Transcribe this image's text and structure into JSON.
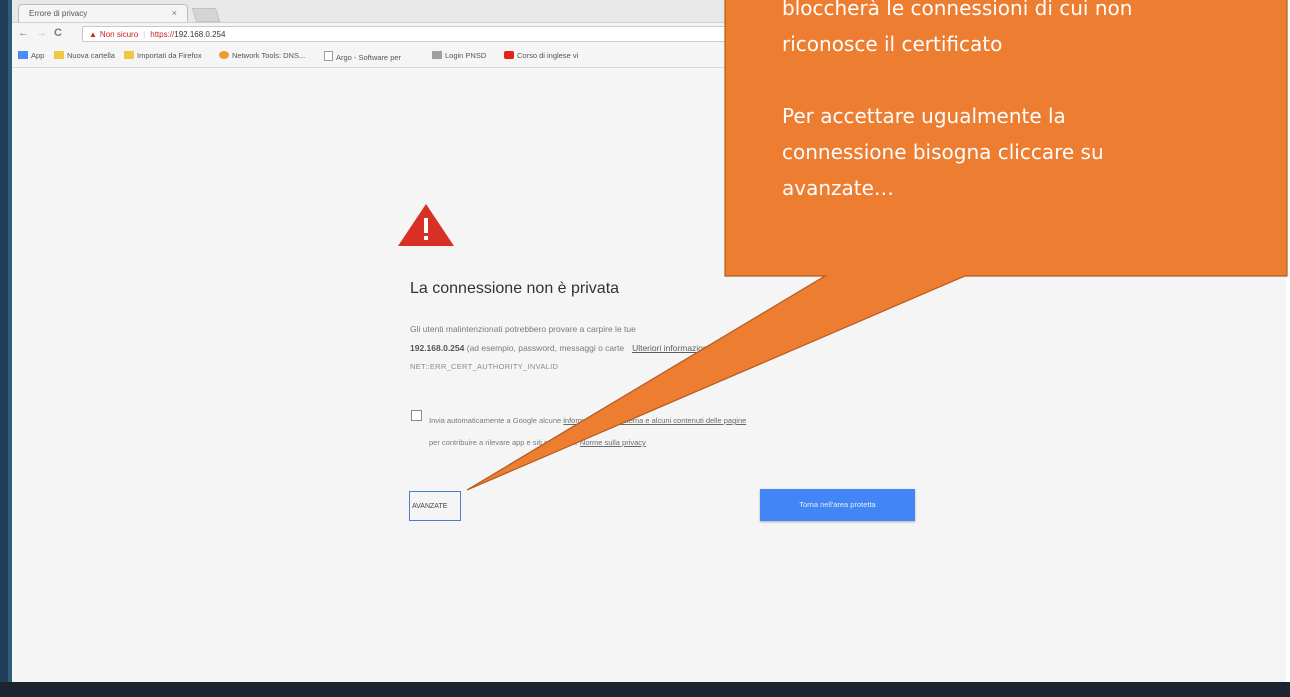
{
  "browser": {
    "tab_title": "Errore di privacy",
    "tab_close": "×",
    "nav": {
      "back": "←",
      "forward": "→",
      "reload": "C"
    },
    "address": {
      "security_text": "Non sicuro",
      "url_scheme": "https://",
      "url_host": "192.168.0.254"
    },
    "bookmarks": [
      {
        "label": "App",
        "color": "#4c8bf5"
      },
      {
        "label": "Nuova cartella",
        "color": "#f2c744"
      },
      {
        "label": "Importati da Firefox",
        "color": "#f2c744"
      },
      {
        "label": "Network Tools: DNS...",
        "color": "#f29a2e"
      },
      {
        "label": "Argo - Software per",
        "color": "#9e9e9e"
      },
      {
        "label": "Login PNSD",
        "color": "#9e9e9e"
      },
      {
        "label": "Corso di inglese vi",
        "color": "#e62117"
      }
    ]
  },
  "error_page": {
    "heading": "La connessione non è privata",
    "para_line1": "Gli utenti malintenzionati potrebbero provare a carpire le tue",
    "para_host": "192.168.0.254",
    "para_line2": "(ad esempio, password, messaggi o carte",
    "more_info": "Ulteriori informazioni",
    "error_code": "NET::ERR_CERT_AUTHORITY_INVALID",
    "checkbox_line1": "Invia automaticamente a Google alcune",
    "checkbox_link1": "informazioni sul sistema e alcuni contenuti delle pagine",
    "checkbox_line2": "per contribuire a rilevare app e siti pericolosi.",
    "privacy_link": "Norme sulla privacy",
    "advanced_button": "AVANZATE",
    "safe_button": "Torna nell'area protetta"
  },
  "callout": {
    "line1": "bloccherà le connessioni di cui non",
    "line2": "riconosce il certificato",
    "line3": "Per accettare ugualmente la",
    "line4": "connessione bisogna cliccare su",
    "line5": "avanzate…",
    "color": "#ed7d31"
  }
}
